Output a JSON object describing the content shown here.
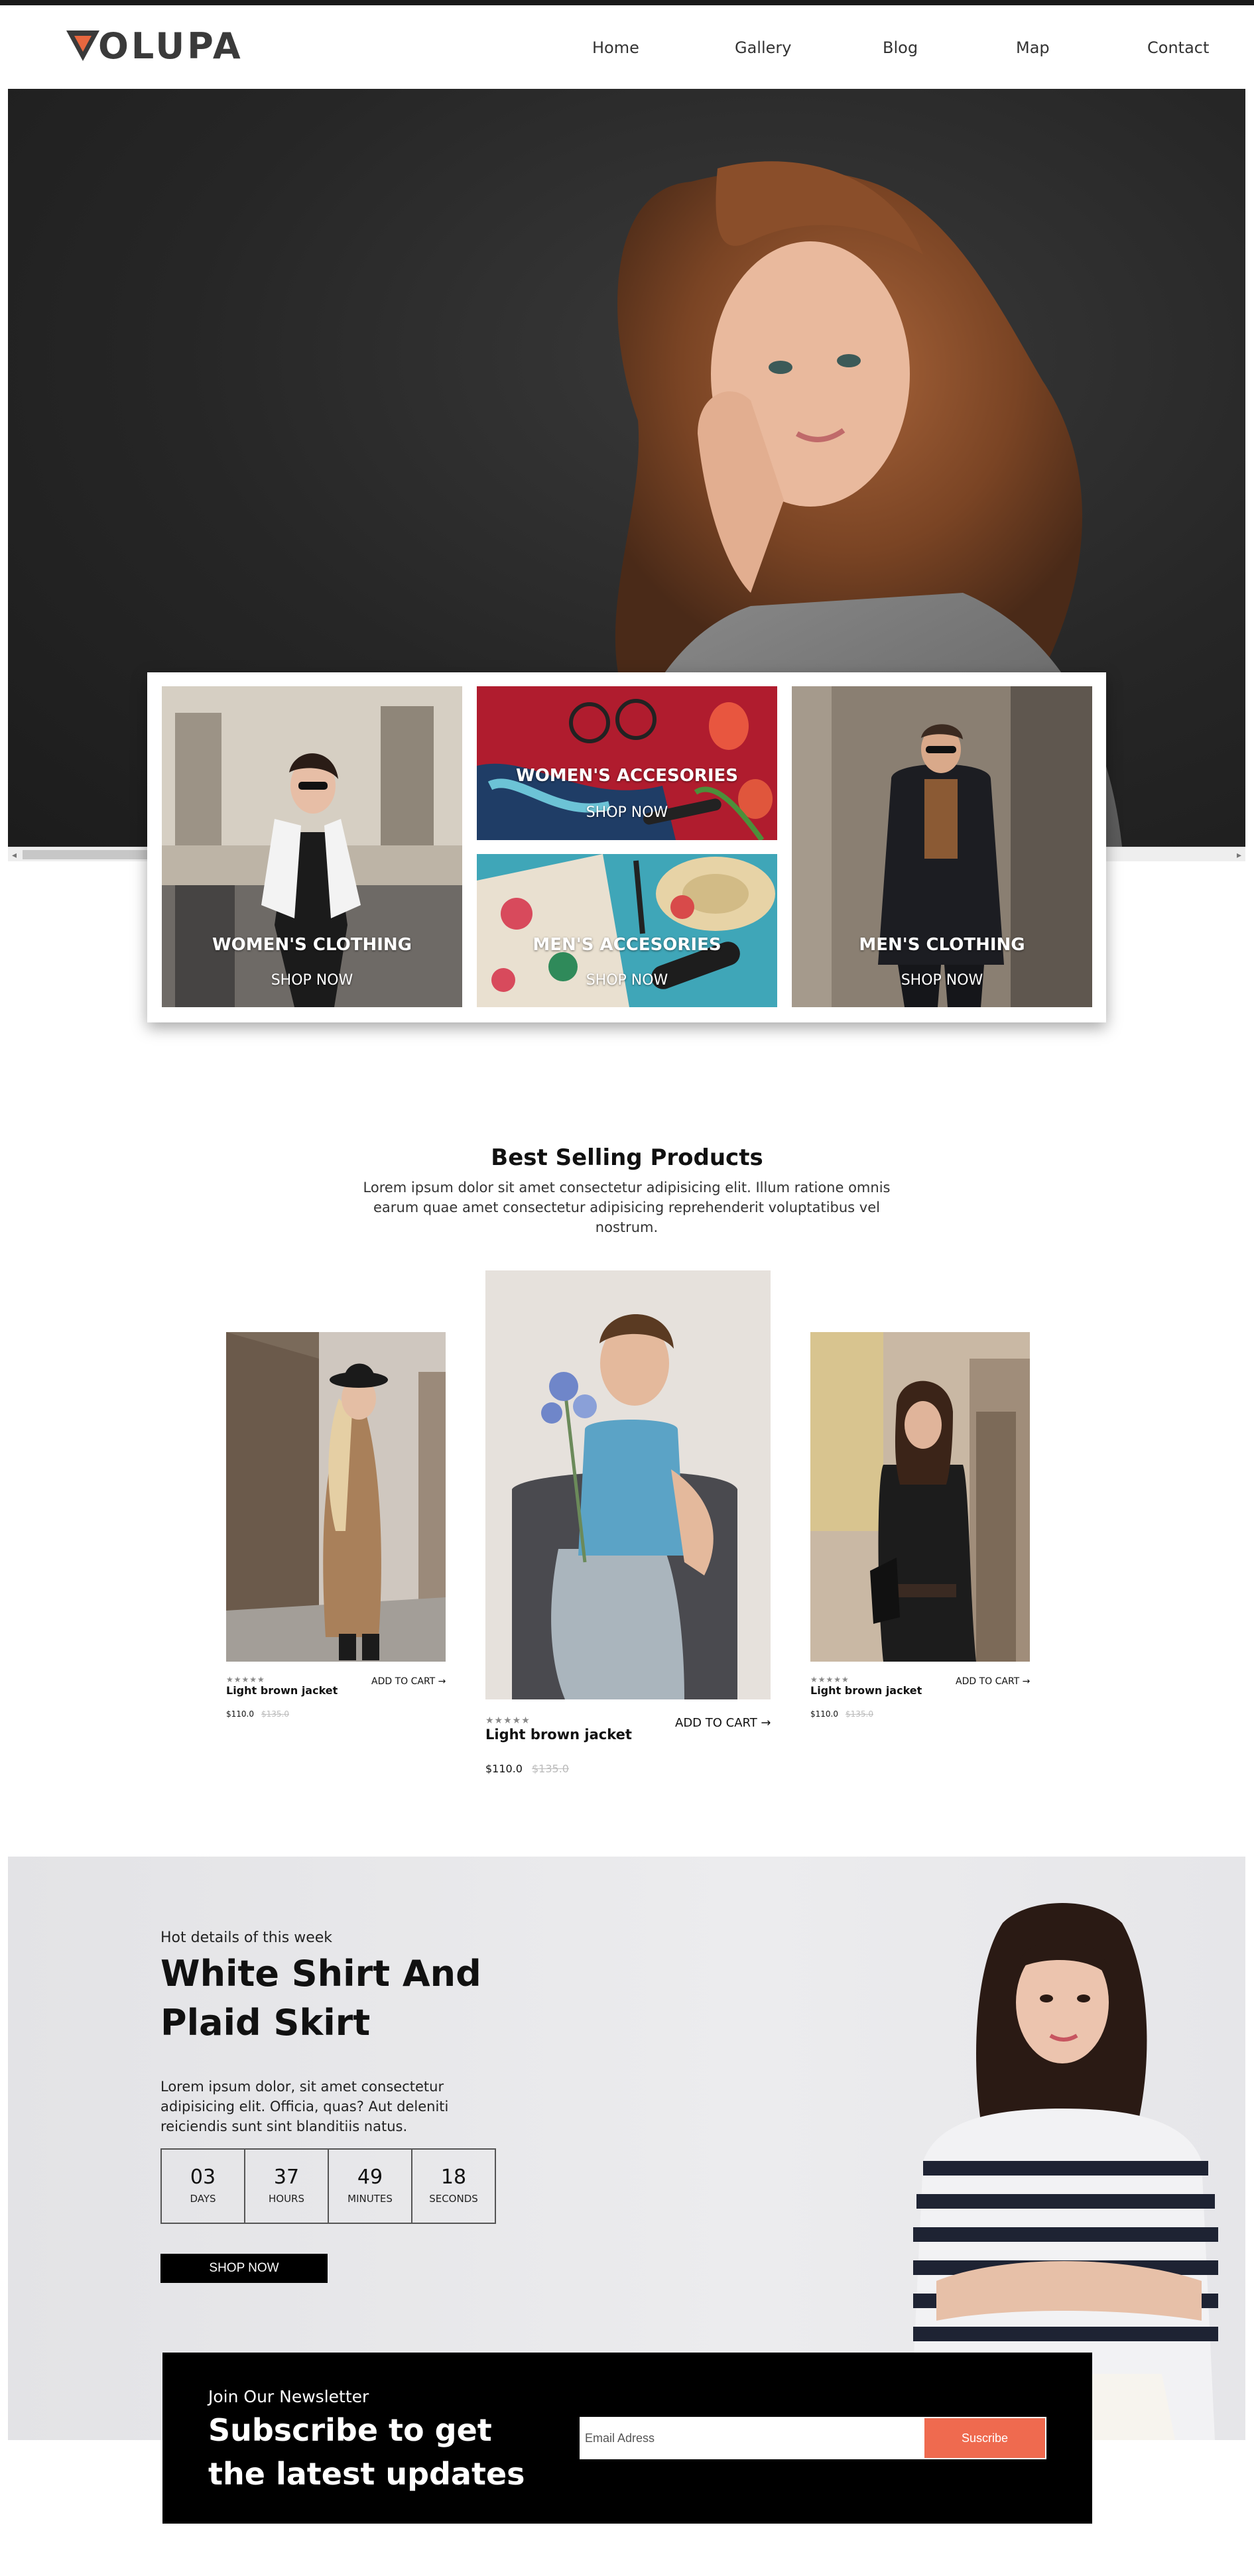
{
  "brand": {
    "name": "VOLUPA",
    "accent": "#e8673f"
  },
  "nav": {
    "items": [
      "Home",
      "Gallery",
      "Blog",
      "Map",
      "Contact"
    ]
  },
  "categories": [
    {
      "label": "WOMEN'S CLOTHING",
      "cta": "SHOP NOW"
    },
    {
      "label": "WOMEN'S ACCESORIES",
      "cta": "SHOP NOW"
    },
    {
      "label": "MEN'S ACCESORIES",
      "cta": "SHOP NOW"
    },
    {
      "label": "MEN'S CLOTHING",
      "cta": "SHOP NOW"
    }
  ],
  "best_selling": {
    "title": "Best Selling Products",
    "subtitle": "Lorem ipsum dolor sit amet consectetur adipisicing elit. Illum ratione omnis earum quae amet consectetur adipisicing reprehenderit voluptatibus vel nostrum.",
    "products": [
      {
        "name": "Light brown jacket",
        "rating_stars": "★★★★★",
        "cart": "ADD TO CART →",
        "price": "$110.0",
        "old_price": "$135.0"
      },
      {
        "name": "Light brown jacket",
        "rating_stars": "★★★★★",
        "cart": "ADD TO CART →",
        "price": "$110.0",
        "old_price": "$135.0"
      },
      {
        "name": "Light brown jacket",
        "rating_stars": "★★★★★",
        "cart": "ADD TO CART →",
        "price": "$110.0",
        "old_price": "$135.0"
      }
    ]
  },
  "deal": {
    "kicker": "Hot details of this week",
    "title": "White Shirt And Plaid Skirt",
    "description": "Lorem ipsum dolor, sit amet consectetur adipisicing elit. Officia, quas? Aut deleniti reiciendis sunt sint blanditiis natus.",
    "countdown": [
      {
        "value": "03",
        "unit": "DAYS"
      },
      {
        "value": "37",
        "unit": "HOURS"
      },
      {
        "value": "49",
        "unit": "MINUTES"
      },
      {
        "value": "18",
        "unit": "SECONDS"
      }
    ],
    "cta": "SHOP NOW"
  },
  "newsletter": {
    "kicker": "Join Our Newsletter",
    "title": "Subscribe to get the latest updates",
    "input_placeholder": "Email Adress",
    "button": "Suscribe",
    "button_color": "#ef6a4f"
  }
}
